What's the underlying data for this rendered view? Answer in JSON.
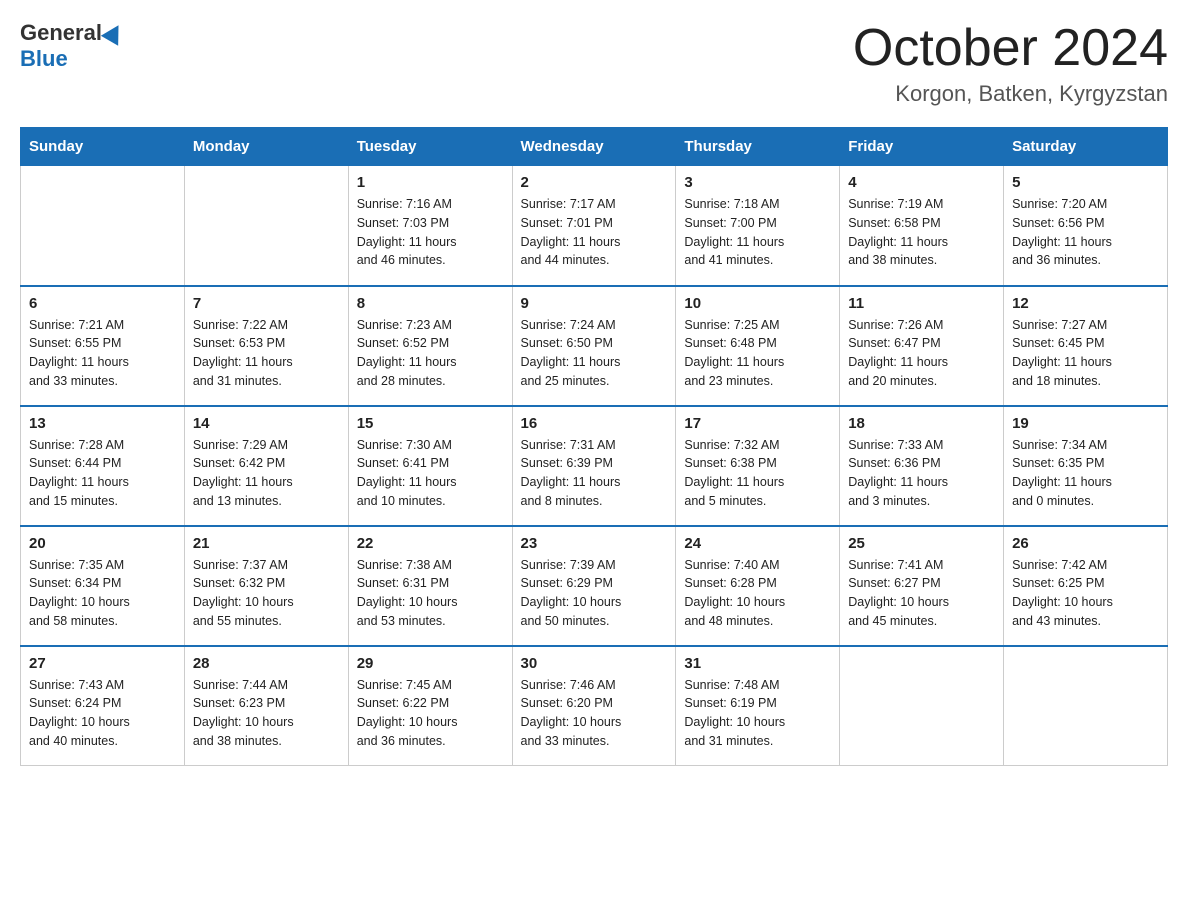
{
  "header": {
    "logo_general": "General",
    "logo_blue": "Blue",
    "title": "October 2024",
    "subtitle": "Korgon, Batken, Kyrgyzstan"
  },
  "days_of_week": [
    "Sunday",
    "Monday",
    "Tuesday",
    "Wednesday",
    "Thursday",
    "Friday",
    "Saturday"
  ],
  "weeks": [
    [
      {
        "day": "",
        "info": ""
      },
      {
        "day": "",
        "info": ""
      },
      {
        "day": "1",
        "info": "Sunrise: 7:16 AM\nSunset: 7:03 PM\nDaylight: 11 hours\nand 46 minutes."
      },
      {
        "day": "2",
        "info": "Sunrise: 7:17 AM\nSunset: 7:01 PM\nDaylight: 11 hours\nand 44 minutes."
      },
      {
        "day": "3",
        "info": "Sunrise: 7:18 AM\nSunset: 7:00 PM\nDaylight: 11 hours\nand 41 minutes."
      },
      {
        "day": "4",
        "info": "Sunrise: 7:19 AM\nSunset: 6:58 PM\nDaylight: 11 hours\nand 38 minutes."
      },
      {
        "day": "5",
        "info": "Sunrise: 7:20 AM\nSunset: 6:56 PM\nDaylight: 11 hours\nand 36 minutes."
      }
    ],
    [
      {
        "day": "6",
        "info": "Sunrise: 7:21 AM\nSunset: 6:55 PM\nDaylight: 11 hours\nand 33 minutes."
      },
      {
        "day": "7",
        "info": "Sunrise: 7:22 AM\nSunset: 6:53 PM\nDaylight: 11 hours\nand 31 minutes."
      },
      {
        "day": "8",
        "info": "Sunrise: 7:23 AM\nSunset: 6:52 PM\nDaylight: 11 hours\nand 28 minutes."
      },
      {
        "day": "9",
        "info": "Sunrise: 7:24 AM\nSunset: 6:50 PM\nDaylight: 11 hours\nand 25 minutes."
      },
      {
        "day": "10",
        "info": "Sunrise: 7:25 AM\nSunset: 6:48 PM\nDaylight: 11 hours\nand 23 minutes."
      },
      {
        "day": "11",
        "info": "Sunrise: 7:26 AM\nSunset: 6:47 PM\nDaylight: 11 hours\nand 20 minutes."
      },
      {
        "day": "12",
        "info": "Sunrise: 7:27 AM\nSunset: 6:45 PM\nDaylight: 11 hours\nand 18 minutes."
      }
    ],
    [
      {
        "day": "13",
        "info": "Sunrise: 7:28 AM\nSunset: 6:44 PM\nDaylight: 11 hours\nand 15 minutes."
      },
      {
        "day": "14",
        "info": "Sunrise: 7:29 AM\nSunset: 6:42 PM\nDaylight: 11 hours\nand 13 minutes."
      },
      {
        "day": "15",
        "info": "Sunrise: 7:30 AM\nSunset: 6:41 PM\nDaylight: 11 hours\nand 10 minutes."
      },
      {
        "day": "16",
        "info": "Sunrise: 7:31 AM\nSunset: 6:39 PM\nDaylight: 11 hours\nand 8 minutes."
      },
      {
        "day": "17",
        "info": "Sunrise: 7:32 AM\nSunset: 6:38 PM\nDaylight: 11 hours\nand 5 minutes."
      },
      {
        "day": "18",
        "info": "Sunrise: 7:33 AM\nSunset: 6:36 PM\nDaylight: 11 hours\nand 3 minutes."
      },
      {
        "day": "19",
        "info": "Sunrise: 7:34 AM\nSunset: 6:35 PM\nDaylight: 11 hours\nand 0 minutes."
      }
    ],
    [
      {
        "day": "20",
        "info": "Sunrise: 7:35 AM\nSunset: 6:34 PM\nDaylight: 10 hours\nand 58 minutes."
      },
      {
        "day": "21",
        "info": "Sunrise: 7:37 AM\nSunset: 6:32 PM\nDaylight: 10 hours\nand 55 minutes."
      },
      {
        "day": "22",
        "info": "Sunrise: 7:38 AM\nSunset: 6:31 PM\nDaylight: 10 hours\nand 53 minutes."
      },
      {
        "day": "23",
        "info": "Sunrise: 7:39 AM\nSunset: 6:29 PM\nDaylight: 10 hours\nand 50 minutes."
      },
      {
        "day": "24",
        "info": "Sunrise: 7:40 AM\nSunset: 6:28 PM\nDaylight: 10 hours\nand 48 minutes."
      },
      {
        "day": "25",
        "info": "Sunrise: 7:41 AM\nSunset: 6:27 PM\nDaylight: 10 hours\nand 45 minutes."
      },
      {
        "day": "26",
        "info": "Sunrise: 7:42 AM\nSunset: 6:25 PM\nDaylight: 10 hours\nand 43 minutes."
      }
    ],
    [
      {
        "day": "27",
        "info": "Sunrise: 7:43 AM\nSunset: 6:24 PM\nDaylight: 10 hours\nand 40 minutes."
      },
      {
        "day": "28",
        "info": "Sunrise: 7:44 AM\nSunset: 6:23 PM\nDaylight: 10 hours\nand 38 minutes."
      },
      {
        "day": "29",
        "info": "Sunrise: 7:45 AM\nSunset: 6:22 PM\nDaylight: 10 hours\nand 36 minutes."
      },
      {
        "day": "30",
        "info": "Sunrise: 7:46 AM\nSunset: 6:20 PM\nDaylight: 10 hours\nand 33 minutes."
      },
      {
        "day": "31",
        "info": "Sunrise: 7:48 AM\nSunset: 6:19 PM\nDaylight: 10 hours\nand 31 minutes."
      },
      {
        "day": "",
        "info": ""
      },
      {
        "day": "",
        "info": ""
      }
    ]
  ]
}
